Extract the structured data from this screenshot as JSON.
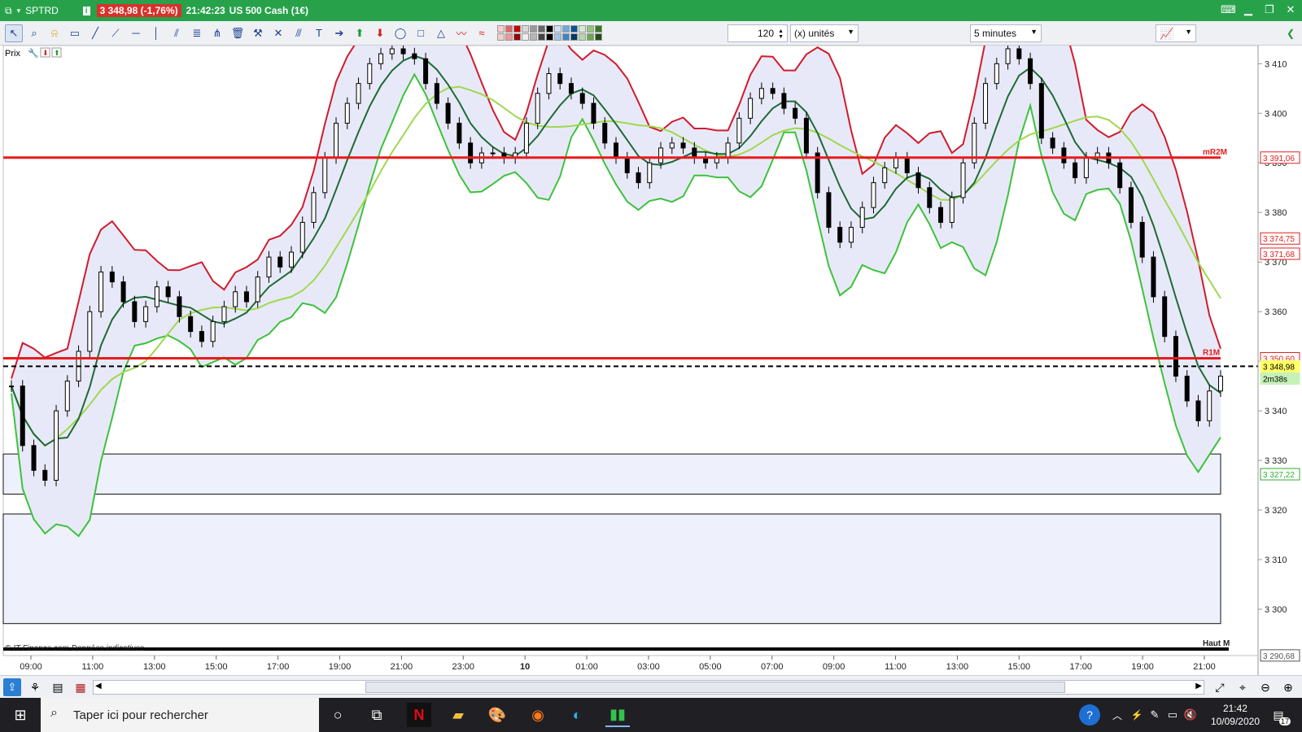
{
  "window": {
    "symbol": "SPTRD",
    "price_badge": "3 348,98 (-1,76%)",
    "time": "21:42:23",
    "instrument": "US 500 Cash (1€)"
  },
  "toolbar": {
    "units_value": "120",
    "units_label": "(x) unités",
    "timeframe": "5 minutes",
    "swatch_colors": [
      "#f4cccc",
      "#e06666",
      "#cc0000",
      "#d9d9d9",
      "#999999",
      "#666666",
      "#000000",
      "#cfe2f3",
      "#6fa8dc",
      "#0b5394",
      "#d9ead3",
      "#93c47d",
      "#38761d",
      "#f4cccc",
      "#ea9999",
      "#990000",
      "#eeeeee",
      "#b7b7b7",
      "#434343",
      "#000000",
      "#9fc5e8",
      "#3d85c6",
      "#073763",
      "#b6d7a8",
      "#6aa84f",
      "#274e13"
    ]
  },
  "chart_header": {
    "label": "Prix"
  },
  "watermark": "© IT-Finance.com  Données indicatives",
  "haut_label": "Haut M",
  "chart_data": {
    "type": "candlestick",
    "y_axis_ticks": [
      "3 410",
      "3 400",
      "3 390",
      "3 380",
      "3 370",
      "3 360",
      "3 350",
      "3 340",
      "3 330",
      "3 320",
      "3 310",
      "3 300"
    ],
    "ylim": [
      3290,
      3413
    ],
    "x_axis_ticks": [
      "09:00",
      "11:00",
      "13:00",
      "15:00",
      "17:00",
      "19:00",
      "21:00",
      "23:00",
      "10",
      "01:00",
      "03:00",
      "05:00",
      "07:00",
      "09:00",
      "11:00",
      "13:00",
      "15:00",
      "17:00",
      "19:00",
      "21:00"
    ],
    "price_labels": [
      {
        "text": "3 391,06",
        "value": 3391.06,
        "color": "#e02020",
        "fg": "#e02020"
      },
      {
        "text": "3 374,75",
        "value": 3374.75,
        "color": "#e02020",
        "fg": "#e02020"
      },
      {
        "text": "3 371,68",
        "value": 3371.68,
        "color": "#e02020",
        "fg": "#e02020"
      },
      {
        "text": "3 350,60",
        "value": 3350.6,
        "color": "#e02020",
        "fg": "#e02020"
      },
      {
        "text": "3 348,98",
        "value": 3348.98,
        "color": "#ffff66",
        "fg": "#000000"
      },
      {
        "text": "2m38s",
        "value": 3346.5,
        "color": "#c6f2b8",
        "fg": "#000000"
      },
      {
        "text": "3 327,22",
        "value": 3327.22,
        "color": "#33aa33",
        "fg": "#33aa33"
      },
      {
        "text": "3 290,68",
        "value": 3290.68,
        "color": "#555555",
        "fg": "#555555"
      }
    ],
    "horizontal_lines": [
      {
        "label": "mR2M",
        "value": 3391.06,
        "color": "#e81c1c"
      },
      {
        "label": "R1M",
        "value": 3350.6,
        "color": "#e81c1c"
      }
    ],
    "current_price": 3348.98,
    "zones": [
      {
        "from": 3323.2,
        "to": 3331.3
      },
      {
        "from": 3297.1,
        "to": 3319.2
      }
    ],
    "close_series": [
      3345,
      3333,
      3328,
      3326,
      3340,
      3346,
      3352,
      3360,
      3368,
      3366,
      3362,
      3358,
      3361,
      3365,
      3363,
      3359,
      3356,
      3354,
      3358,
      3361,
      3364,
      3362,
      3367,
      3371,
      3369,
      3372,
      3378,
      3384,
      3391,
      3398,
      3402,
      3406,
      3410,
      3412,
      3413,
      3412,
      3411,
      3406,
      3402,
      3398,
      3394,
      3390,
      3392,
      3392,
      3391,
      3392,
      3398,
      3404,
      3408,
      3406,
      3404,
      3402,
      3398,
      3394,
      3391,
      3388,
      3386,
      3390,
      3393,
      3394,
      3393,
      3391,
      3390,
      3391,
      3394,
      3399,
      3403,
      3405,
      3404,
      3401,
      3399,
      3392,
      3384,
      3377,
      3374,
      3377,
      3381,
      3386,
      3389,
      3391,
      3388,
      3385,
      3381,
      3378,
      3383,
      3390,
      3398,
      3406,
      3410,
      3413,
      3411,
      3406,
      3395,
      3393,
      3390,
      3387,
      3391,
      3392,
      3390,
      3385,
      3378,
      3371,
      3363,
      3355,
      3347,
      3342,
      3338,
      3344,
      3347
    ]
  },
  "bottombar": {
    "icons": [
      "share-icon",
      "indicator-icon",
      "list-icon",
      "strategy-icon",
      "zoom-fit-icon",
      "zoom-reset-icon",
      "zoom-out-icon",
      "zoom-in-icon"
    ]
  },
  "taskbar": {
    "search_placeholder": "Taper ici pour rechercher",
    "time": "21:42",
    "date": "10/09/2020",
    "notif_count": "17"
  }
}
